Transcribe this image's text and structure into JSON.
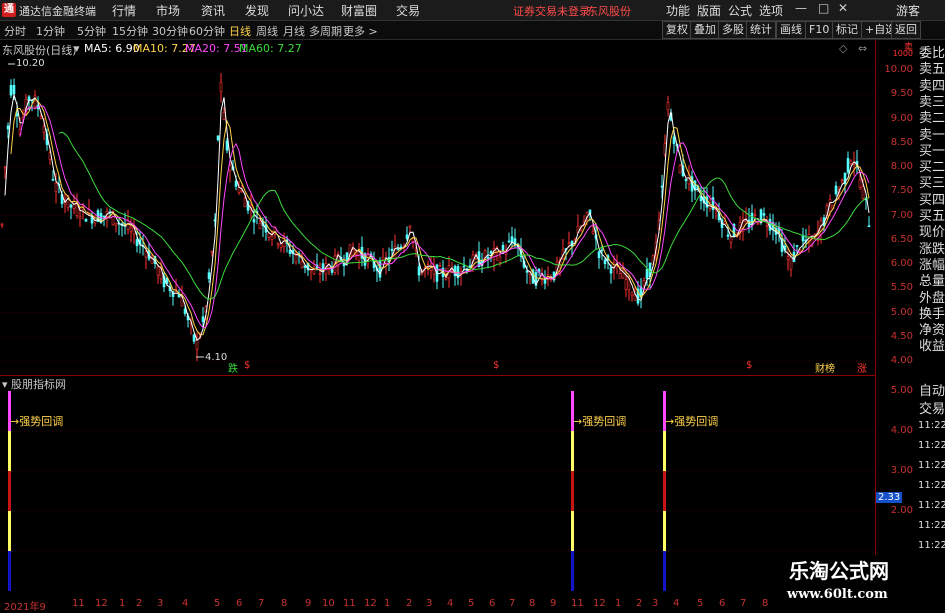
{
  "app": {
    "title": "通达信金融终端",
    "logo_char": "通"
  },
  "menu": [
    "行情",
    "市场",
    "资讯",
    "发现",
    "问小达",
    "财富圈",
    "交易"
  ],
  "status": {
    "login": "证券交易未登录",
    "stock": "东风股份"
  },
  "right_menu": [
    "功能",
    "版面",
    "公式",
    "选项"
  ],
  "window_controls": {
    "user": "游客",
    "minimize": "—",
    "maximize": "□",
    "close": "✕"
  },
  "periods": [
    "分时",
    "1分钟",
    "5分钟",
    "15分钟",
    "30分钟",
    "60分钟",
    "日线",
    "周线",
    "月线",
    "多周期",
    "更多 >"
  ],
  "active_period": "日线",
  "toolbar_right": [
    "复权",
    "叠加",
    "多股",
    "统计",
    "画线",
    "F10",
    "标记",
    "+自选",
    "返回"
  ],
  "chart_title": "东风股份(日线)",
  "ma": [
    {
      "label": "MA5: 6.90",
      "color": "#ffffff"
    },
    {
      "label": "MA10: 7.27",
      "color": "#ffd24a"
    },
    {
      "label": "MA20: 7.51",
      "color": "#ff48ff"
    },
    {
      "label": "MA60: 7.27",
      "color": "#3cdc3c"
    }
  ],
  "annotations": {
    "high": "10.20",
    "low": "4.10"
  },
  "event_marks": [
    "跌",
    "$",
    "$",
    "$",
    "财榜",
    "涨"
  ],
  "sub_title": "股朋指标网",
  "signals": [
    "强势回调",
    "强势回调",
    "强势回调"
  ],
  "yaxis_main": [
    "10.00",
    "9.50",
    "9.00",
    "8.50",
    "8.00",
    "7.50",
    "7.00",
    "6.50",
    "6.00",
    "5.50",
    "5.00",
    "4.50",
    "4.00"
  ],
  "yaxis_sub": [
    "5.00",
    "4.00",
    "3.00",
    "2.00"
  ],
  "sub_current": "2.33",
  "xaxis": [
    "2021年9",
    "11",
    "12",
    "1",
    "2",
    "3",
    "4",
    "5",
    "6",
    "7",
    "8",
    "9",
    "10",
    "11",
    "12",
    "1",
    "2",
    "3",
    "4",
    "5",
    "6",
    "7",
    "8",
    "9",
    "11",
    "12",
    "1",
    "2",
    "3",
    "4",
    "5",
    "6",
    "7",
    "8"
  ],
  "right_panel": [
    "委比",
    "卖五",
    "卖四",
    "卖三",
    "卖二",
    "卖一",
    "买一",
    "买二",
    "买三",
    "买四",
    "买五",
    "现价",
    "涨跌",
    "涨幅",
    "总量",
    "外盘",
    "换手",
    "净资",
    "收益"
  ],
  "right_panel2": [
    "自动",
    "交易",
    "11:22",
    "11:22",
    "11:22",
    "11:22",
    "11:22",
    "11:22",
    "11:22",
    "11:22",
    "11:22"
  ],
  "right_top_small": [
    "卖",
    "1000"
  ],
  "watermark": {
    "line1": "乐淘公式网",
    "line2": "www.60lt.com"
  },
  "colors": {
    "up": "#ff3232",
    "down": "#54ffff",
    "axis": "#c83232",
    "ma5": "#ffffff",
    "ma10": "#ffd24a",
    "ma20": "#ff48ff",
    "ma60": "#3cdc3c"
  }
}
